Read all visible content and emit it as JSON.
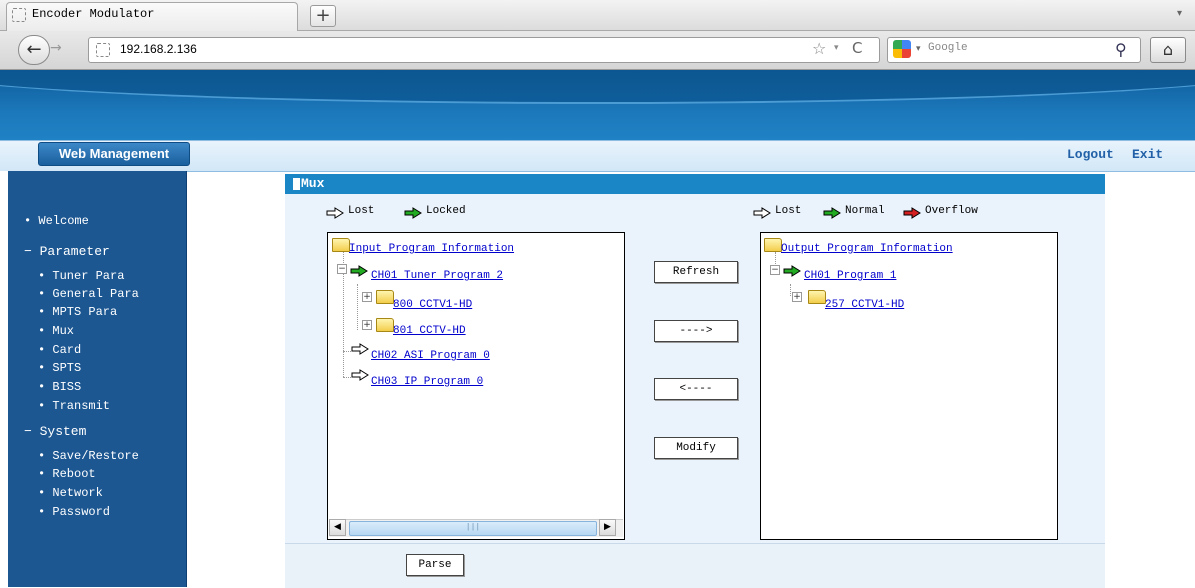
{
  "browser": {
    "tab_title": "Encoder Modulator",
    "new_tab": "+",
    "tab_menu": "▾",
    "back": "←",
    "forward": "→",
    "url": "192.168.2.136",
    "star": "☆",
    "dropdown": "▾",
    "reload": "C",
    "search_dropdown": "▾",
    "search_placeholder": "Google",
    "search_icon": "⚲",
    "home": "⌂"
  },
  "header": {
    "web_management": "Web Management",
    "logout": "Logout",
    "exit": "Exit"
  },
  "sidebar": {
    "items": [
      {
        "label": "• Welcome"
      },
      {
        "label": "− Parameter"
      },
      {
        "label": "• Tuner Para"
      },
      {
        "label": "• General Para"
      },
      {
        "label": "• MPTS Para"
      },
      {
        "label": "• Mux"
      },
      {
        "label": "• Card"
      },
      {
        "label": "• SPTS"
      },
      {
        "label": "• BISS"
      },
      {
        "label": "• Transmit"
      },
      {
        "label": "− System"
      },
      {
        "label": "• Save/Restore"
      },
      {
        "label": "• Reboot"
      },
      {
        "label": "• Network"
      },
      {
        "label": "• Password"
      }
    ]
  },
  "mux": {
    "title": "Mux",
    "input_legend": {
      "lost": "Lost",
      "locked": "Locked"
    },
    "output_legend": {
      "lost": "Lost",
      "normal": "Normal",
      "overflow": "Overflow"
    },
    "colors": {
      "lost": "#ffffff",
      "locked": "#22aa22",
      "normal": "#22aa22",
      "overflow": "#d42020",
      "accent": "#1b86c6"
    },
    "input_tree": {
      "root": "Input Program Information",
      "ch1": "CH01 Tuner Program 2",
      "ch1_prog1": "800 CCTV1-HD",
      "ch1_prog2": "801 CCTV-HD",
      "ch2": "CH02 ASI Program 0",
      "ch3": "CH03 IP Program 0"
    },
    "output_tree": {
      "root": "Output Program Information",
      "ch1": "CH01 Program 1",
      "ch1_prog1": "257 CCTV1-HD"
    },
    "buttons": {
      "refresh": "Refresh",
      "add": "---->",
      "remove": "<----",
      "modify": "Modify",
      "parse": "Parse"
    },
    "scroll": {
      "left": "◀",
      "right": "▶",
      "thumb": "|||"
    }
  }
}
